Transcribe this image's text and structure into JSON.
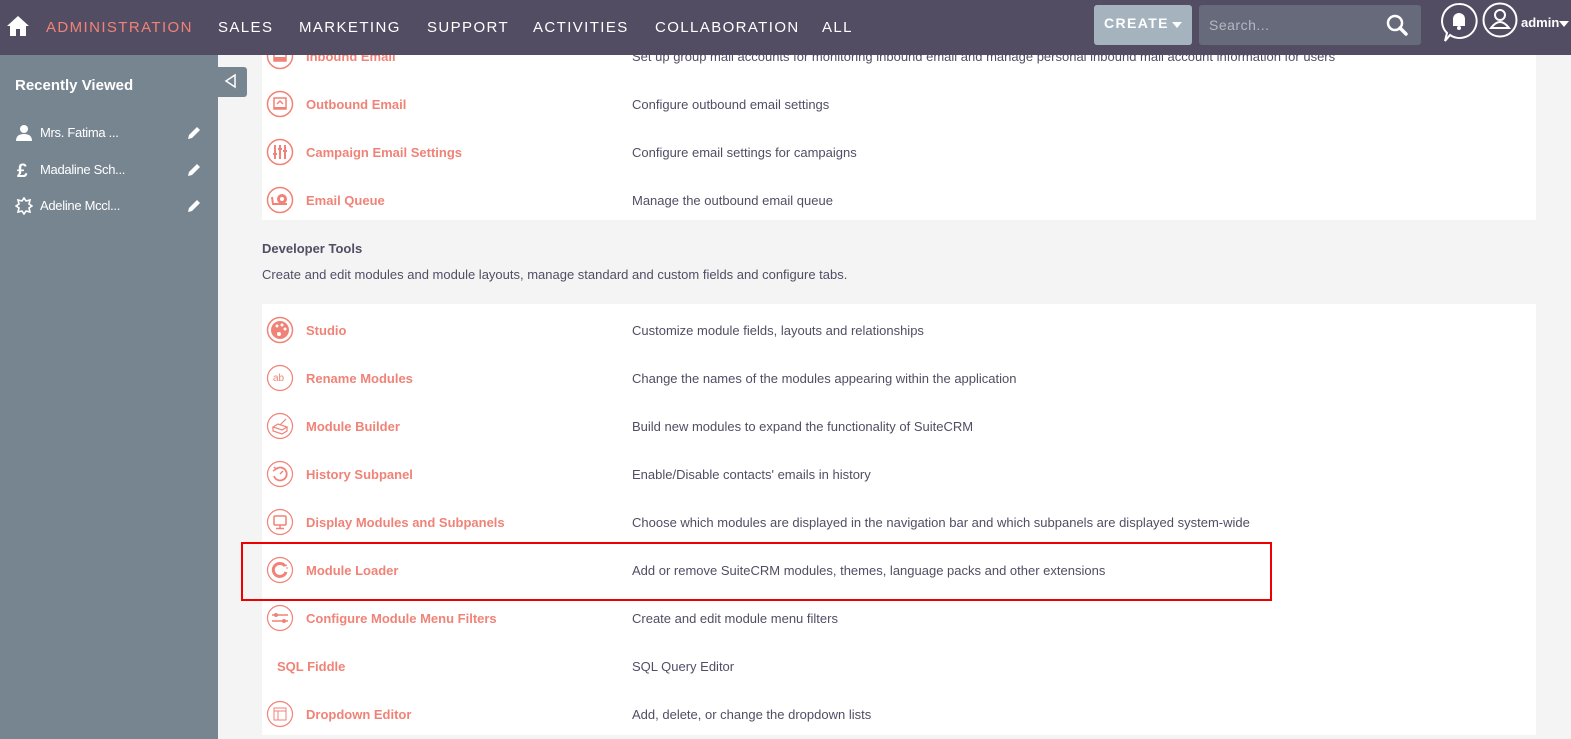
{
  "topnav": {
    "home_icon": "home-icon",
    "items": [
      {
        "label": "ADMINISTRATION",
        "active": true
      },
      {
        "label": "SALES",
        "active": false
      },
      {
        "label": "MARKETING",
        "active": false
      },
      {
        "label": "SUPPORT",
        "active": false
      },
      {
        "label": "ACTIVITIES",
        "active": false
      },
      {
        "label": "COLLABORATION",
        "active": false
      },
      {
        "label": "ALL",
        "active": false
      }
    ],
    "create_label": "CREATE",
    "search_placeholder": "Search...",
    "search_value": "",
    "user_name": "admin"
  },
  "sidebar": {
    "title": "Recently Viewed",
    "items": [
      {
        "label": "Mrs. Fatima ...",
        "icon": "contact-icon"
      },
      {
        "label": "Madaline Sch...",
        "icon": "pound-icon"
      },
      {
        "label": "Adeline Mccl...",
        "icon": "badge-icon"
      }
    ]
  },
  "email_section": {
    "rows": [
      {
        "label": "Inbound Email",
        "description": "Set up group mail accounts for monitoring inbound email and manage personal inbound mail account information for users",
        "icon": "inbound-email-icon"
      },
      {
        "label": "Outbound Email",
        "description": "Configure outbound email settings",
        "icon": "outbound-email-icon"
      },
      {
        "label": "Campaign Email Settings",
        "description": "Configure email settings for campaigns",
        "icon": "sliders-icon"
      },
      {
        "label": "Email Queue",
        "description": "Manage the outbound email queue",
        "icon": "snail-icon"
      }
    ]
  },
  "developer_tools": {
    "title": "Developer Tools",
    "description": "Create and edit modules and module layouts, manage standard and custom fields and configure tabs.",
    "rows": [
      {
        "label": "Studio",
        "description": "Customize module fields, layouts and relationships",
        "icon": "palette-icon"
      },
      {
        "label": "Rename Modules",
        "description": "Change the names of the modules appearing within the application",
        "icon": "ab-icon"
      },
      {
        "label": "Module Builder",
        "description": "Build new modules to expand the functionality of SuiteCRM",
        "icon": "module-builder-icon"
      },
      {
        "label": "History Subpanel",
        "description": "Enable/Disable contacts' emails in history",
        "icon": "history-icon"
      },
      {
        "label": "Display Modules and Subpanels",
        "description": "Choose which modules are displayed in the navigation bar and which subpanels are displayed system-wide",
        "icon": "monitor-icon"
      },
      {
        "label": "Module Loader",
        "description": "Add or remove SuiteCRM modules, themes, language packs and other extensions",
        "icon": "module-loader-icon",
        "highlighted": true
      },
      {
        "label": "Configure Module Menu Filters",
        "description": "Create and edit module menu filters",
        "icon": "filter-sliders-icon"
      },
      {
        "label": "SQL Fiddle",
        "description": "SQL Query Editor",
        "icon": ""
      },
      {
        "label": "Dropdown Editor",
        "description": "Add, delete, or change the dropdown lists",
        "icon": "dropdown-editor-icon"
      }
    ]
  },
  "colors": {
    "nav_bg": "#534d64",
    "accent": "#f08377",
    "sidebar_bg": "#778591",
    "highlight": "#ee0000"
  }
}
